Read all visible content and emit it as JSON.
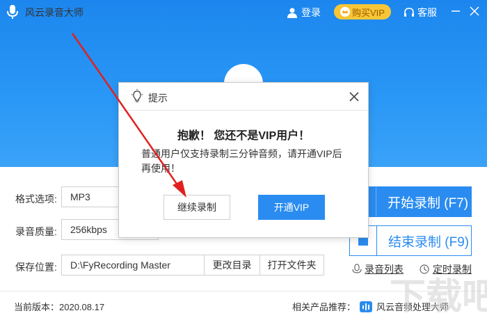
{
  "app": {
    "title": "风云录音大师"
  },
  "titlebar": {
    "login_label": "登录",
    "vip_label": "购买VIP",
    "service_label": "客服"
  },
  "form": {
    "format_label": "格式选项:",
    "format_value": "MP3",
    "quality_label": "录音质量:",
    "quality_value": "256kbps",
    "save_label": "保存位置:",
    "save_path": "D:\\FyRecording Master",
    "change_dir_label": "更改目录",
    "open_folder_label": "打开文件夹"
  },
  "actions": {
    "start_label": "开始录制 (F7)",
    "end_label": "结束录制 (F9)"
  },
  "links": {
    "list_label": "录音列表",
    "timer_label": "定时录制"
  },
  "footer": {
    "version_label": "当前版本：2020.08.17",
    "related_label": "相关产品推荐：",
    "product_label": "风云音频处理大师"
  },
  "modal": {
    "title": "提示",
    "heading": "抱歉！ 您还不是VIP用户！",
    "body": "普通用户仅支持录制三分钟音频，请开通VIP后再使用！",
    "continue_label": "继续录制",
    "open_vip_label": "开通VIP"
  },
  "colors": {
    "primary": "#2a8cf0",
    "vip": "#f7c636",
    "arrow": "#e02020"
  }
}
